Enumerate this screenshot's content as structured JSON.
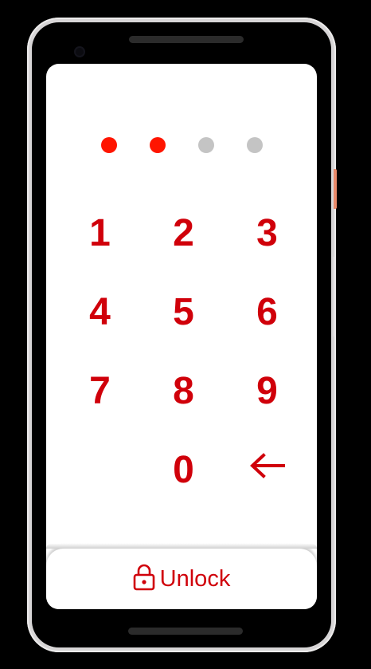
{
  "colors": {
    "accent": "#d0000a",
    "dot_filled": "#ff1500",
    "dot_empty": "#c4c4c4",
    "screen_bg": "#ffffff",
    "frame": "#d7d5d6"
  },
  "pin": {
    "length": 4,
    "entered": 2
  },
  "keypad": {
    "keys": [
      "1",
      "2",
      "3",
      "4",
      "5",
      "6",
      "7",
      "8",
      "9",
      "",
      "0",
      "backspace"
    ]
  },
  "unlock_button": {
    "label": "Unlock",
    "icon": "lock-icon"
  }
}
